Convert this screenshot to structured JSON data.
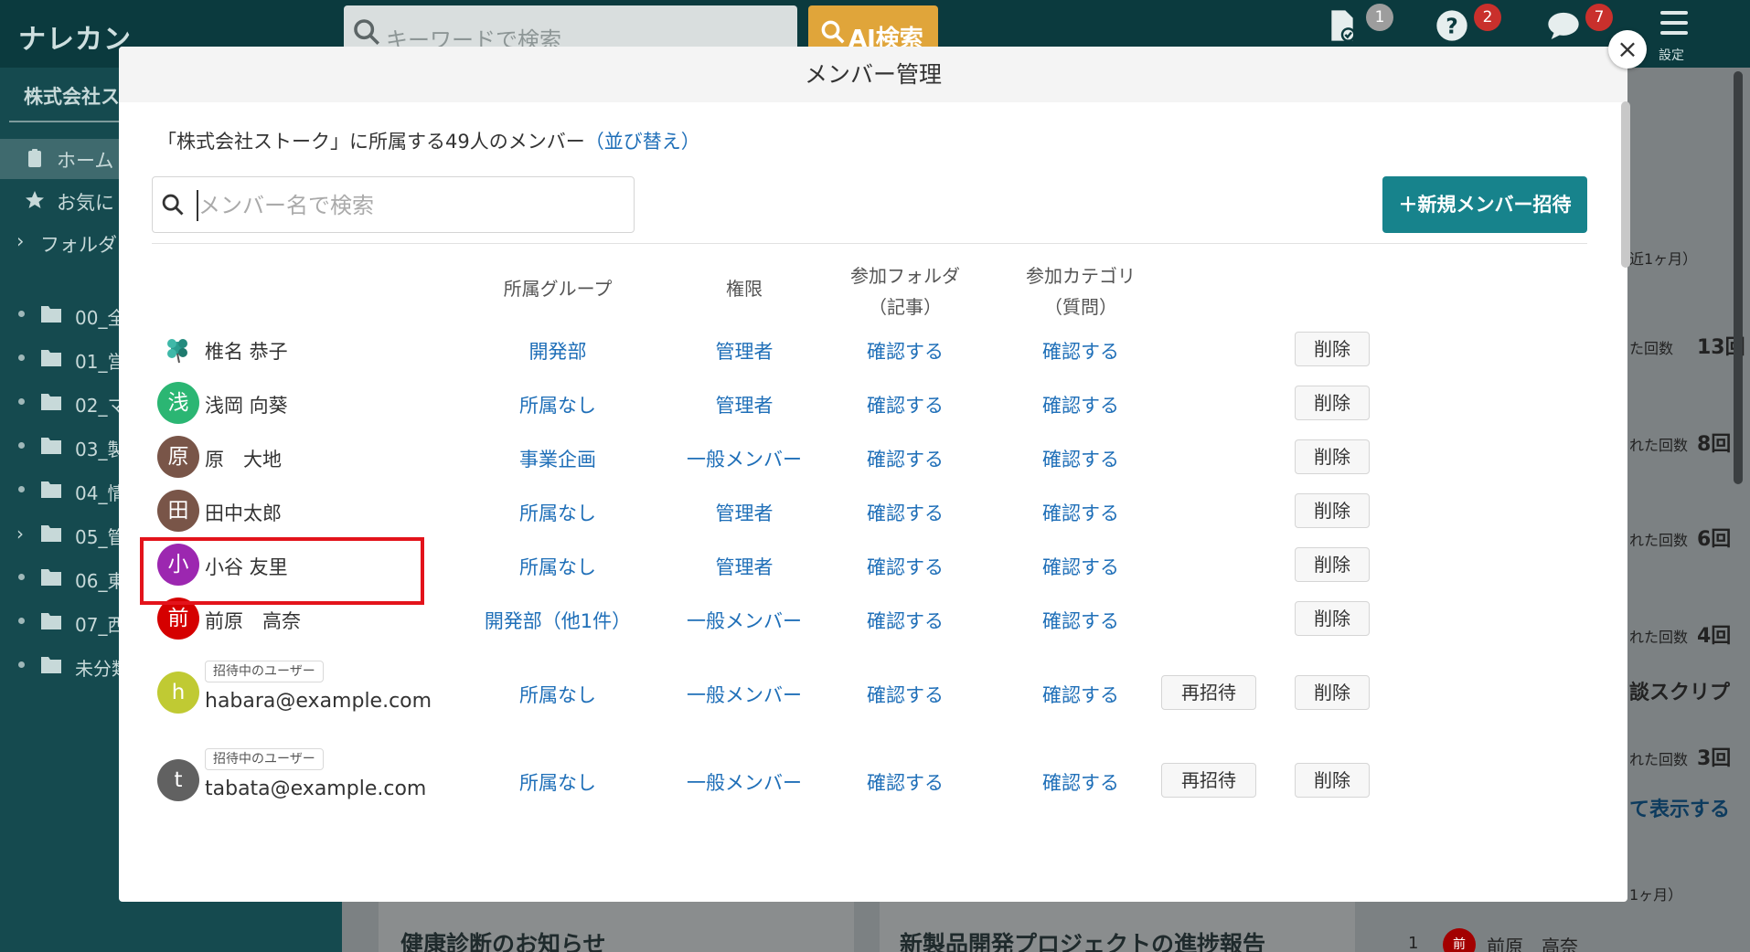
{
  "app": {
    "logo": "ナレカン",
    "search_placeholder": "キーワードで検索",
    "ai_search_label": "AI検索",
    "badges": {
      "docs": "1",
      "help": "2",
      "messages": "7"
    },
    "settings_label": "設定"
  },
  "sidebar": {
    "company": "株式会社ス",
    "home": "ホーム",
    "favorites": "お気に",
    "folders_label": "フォルダ",
    "folders": [
      "00_全",
      "01_営",
      "02_マ",
      "03_製",
      "04_情",
      "05_管",
      "06_東",
      "07_西",
      "未分類"
    ]
  },
  "background": {
    "card1_title": "健康診断のお知らせ",
    "card2_title": "新製品開発プロジェクトの進捗報告",
    "right_period": "近1ヶ月）",
    "right_period2": "1ヶ月）",
    "stats": [
      {
        "label": "た回数",
        "value": "13回"
      },
      {
        "label": "れた回数",
        "value": "8回"
      },
      {
        "label": "れた回数",
        "value": "6回"
      },
      {
        "label": "れた回数",
        "value": "4回"
      },
      {
        "label": "れた回数",
        "value": "3回"
      }
    ],
    "script_label": "談スクリプ",
    "show_more": "て表示する",
    "ranking_num": "1",
    "ranking_avatar": "前",
    "ranking_name": "前原　高奈"
  },
  "modal": {
    "title": "メンバー管理",
    "count_text": "「株式会社ストーク」に所属する49人のメンバー",
    "sort_link": "（並び替え）",
    "search_placeholder": "メンバー名で検索",
    "invite_button": "＋新規メンバー招待",
    "columns": {
      "group": "所属グループ",
      "role": "権限",
      "folder_line1": "参加フォルダ",
      "folder_line2": "（記事）",
      "category_line1": "参加カテゴリ",
      "category_line2": "（質問）"
    },
    "invite_tag": "招待中のユーザー",
    "confirm_label": "確認する",
    "delete_label": "削除",
    "reinvite_label": "再招待",
    "members": [
      {
        "name": "椎名 恭子",
        "avatar": "",
        "avatar_color": "",
        "group": "開発部",
        "role": "管理者"
      },
      {
        "name": "浅岡 向葵",
        "avatar": "浅",
        "avatar_color": "#2bb673",
        "group": "所属なし",
        "role": "管理者"
      },
      {
        "name": "原　大地",
        "avatar": "原",
        "avatar_color": "#795548",
        "group": "事業企画",
        "role": "一般メンバー"
      },
      {
        "name": "田中太郎",
        "avatar": "田",
        "avatar_color": "#795548",
        "group": "所属なし",
        "role": "管理者"
      },
      {
        "name": "小谷 友里",
        "avatar": "小",
        "avatar_color": "#9c27b0",
        "group": "所属なし",
        "role": "管理者"
      },
      {
        "name": "前原　高奈",
        "avatar": "前",
        "avatar_color": "#d50000",
        "group": "開発部（他1件）",
        "role": "一般メンバー"
      },
      {
        "email": "habara@example.com",
        "avatar": "h",
        "avatar_color": "#c0ca33",
        "group": "所属なし",
        "role": "一般メンバー"
      },
      {
        "email": "tabata@example.com",
        "avatar": "t",
        "avatar_color": "#616161",
        "group": "所属なし",
        "role": "一般メンバー"
      }
    ]
  }
}
